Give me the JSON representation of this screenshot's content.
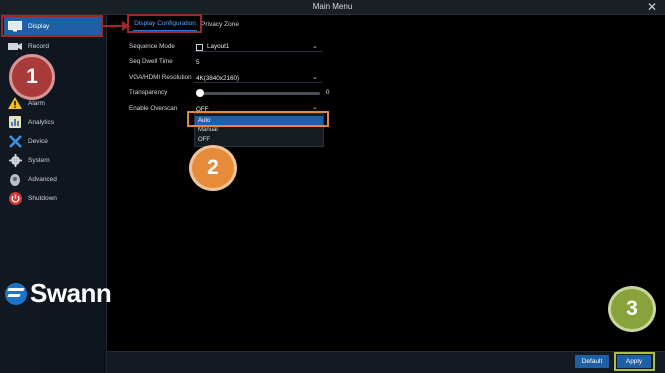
{
  "window": {
    "title": "Main Menu",
    "close_glyph": "✕"
  },
  "sidebar": {
    "items": [
      {
        "label": "Display",
        "icon": "monitor-icon",
        "active": true
      },
      {
        "label": "Record",
        "icon": "camera-icon"
      },
      {
        "label": "Alarm",
        "icon": "warning-icon"
      },
      {
        "label": "Analytics",
        "icon": "analytics-icon"
      },
      {
        "label": "Device",
        "icon": "tools-icon"
      },
      {
        "label": "System",
        "icon": "gear-icon"
      },
      {
        "label": "Advanced",
        "icon": "advanced-icon"
      },
      {
        "label": "Shutdown",
        "icon": "power-icon"
      }
    ],
    "logo_text": "Swann"
  },
  "tabs": [
    {
      "label": "Display Configuration",
      "active": true
    },
    {
      "label": "Privacy Zone"
    }
  ],
  "form": {
    "sequence_mode": {
      "label": "Sequence Mode",
      "value": "Layout1"
    },
    "seq_dwell_time": {
      "label": "Seq Dwell Time",
      "value": "5"
    },
    "resolution": {
      "label": "VGA/HDMI Resolution",
      "value": "4K(3840x2160)"
    },
    "transparency": {
      "label": "Transparency",
      "value": "0",
      "level": 0
    },
    "overscan": {
      "label": "Enable Overscan",
      "value": "OFF"
    }
  },
  "dropdown": {
    "options": [
      "Auto",
      "Manual",
      "OFF"
    ],
    "selected": "Auto"
  },
  "annotations": {
    "step1": "1",
    "step2": "2",
    "step3": "3"
  },
  "buttons": {
    "default": "Default",
    "apply": "Apply"
  },
  "colors": {
    "accent": "#1f5fa5",
    "step1": "#a83a3a",
    "step2": "#e58b3a",
    "step3": "#88a23c"
  }
}
